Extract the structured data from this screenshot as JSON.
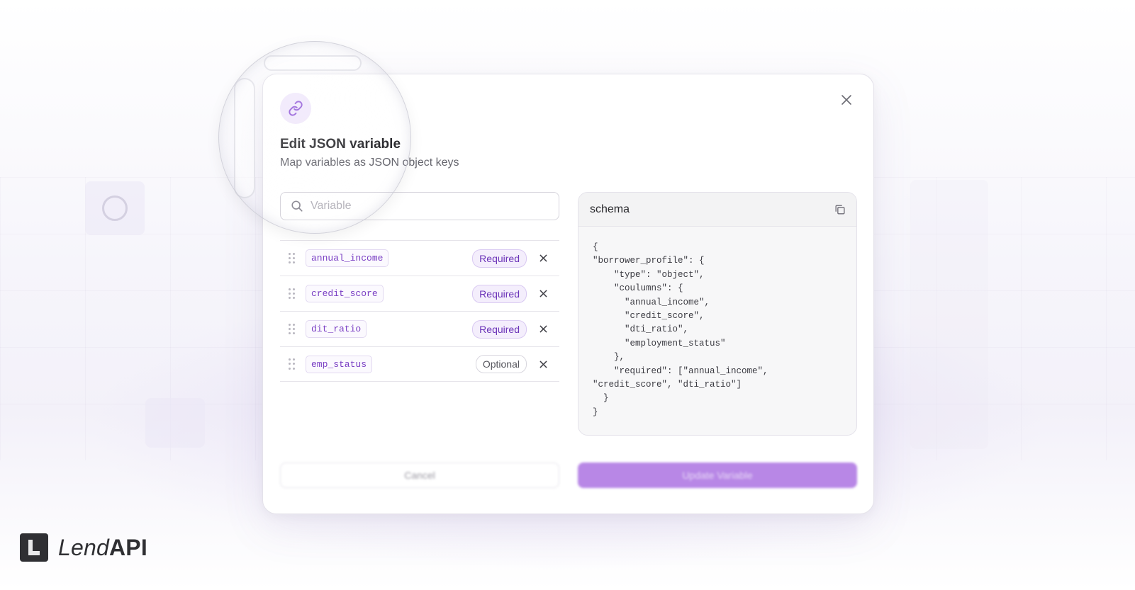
{
  "dialog": {
    "title": "Edit JSON variable",
    "subtitle": "Map variables as JSON object keys",
    "search": {
      "placeholder": "Variable",
      "value": ""
    },
    "variables": [
      {
        "key": "annual_income",
        "status": "Required"
      },
      {
        "key": "credit_score",
        "status": "Required"
      },
      {
        "key": "dit_ratio",
        "status": "Required"
      },
      {
        "key": "emp_status",
        "status": "Optional"
      }
    ],
    "schema": {
      "title": "schema",
      "code": "{\n\"borrower_profile\": {\n    \"type\": \"object\",\n    \"coulumns\": {\n      \"annual_income\",\n      \"credit_score\",\n      \"dti_ratio\",\n      \"employment_status\"\n    },\n    \"required\": [\"annual_income\",\n\"credit_score\", \"dti_ratio\"]\n  }\n}"
    },
    "footer": {
      "cancel_label": "Cancel",
      "update_label": "Update Variable"
    }
  },
  "brand": {
    "name_light": "Lend",
    "name_bold": "API"
  },
  "colors": {
    "accent": "#7a3fc4",
    "accent_soft": "#efe6fb",
    "primary_button": "#b887e6"
  },
  "icons": {
    "title_icon": "link-icon",
    "close": "close-icon",
    "search": "search-icon",
    "copy": "copy-icon",
    "drag": "drag-handle-icon",
    "remove": "remove-icon"
  }
}
